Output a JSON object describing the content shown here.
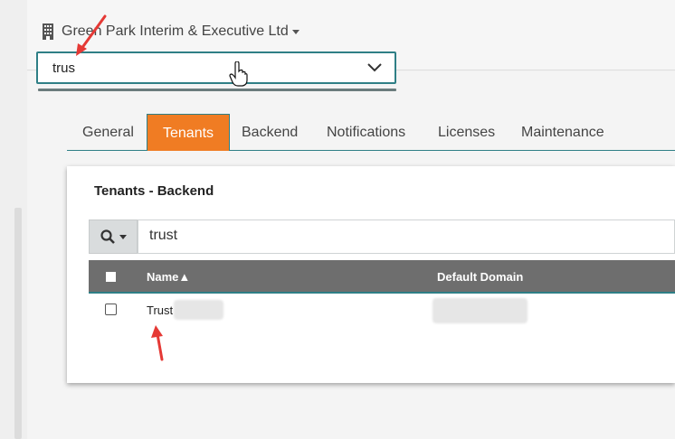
{
  "header": {
    "org_name": "Green Park Interim & Executive Ltd",
    "org_icon": "building-icon"
  },
  "tenant_dropdown": {
    "value": "trus",
    "icon": "chevron-down-icon"
  },
  "tabs": [
    {
      "label": "General",
      "active": false
    },
    {
      "label": "Tenants",
      "active": true
    },
    {
      "label": "Backend",
      "active": false
    },
    {
      "label": "Notifications",
      "active": false
    },
    {
      "label": "Licenses",
      "active": false
    },
    {
      "label": "Maintenance",
      "active": false
    }
  ],
  "panel": {
    "title": "Tenants - Backend",
    "search": {
      "value": "trust",
      "icon": "search-icon"
    },
    "table": {
      "columns": [
        "Name▲",
        "Default Domain"
      ],
      "rows": [
        {
          "name": "Trust",
          "default_domain": ""
        }
      ]
    }
  },
  "colors": {
    "accent": "#f07c23",
    "teal": "#2f7f86",
    "table_header": "#6e6e6e",
    "annotation_arrow": "#e53935"
  }
}
